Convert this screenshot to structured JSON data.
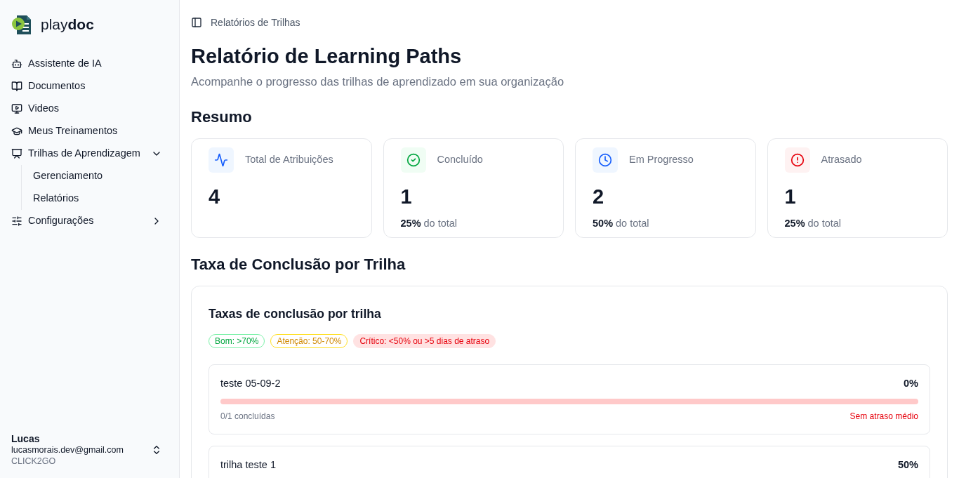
{
  "sidebar": {
    "logo": "play**doc**",
    "items": [
      {
        "kind": "bot",
        "label": "Assistente de IA"
      },
      {
        "kind": "book",
        "label": "Documentos"
      },
      {
        "kind": "monitor",
        "label": "Videos"
      },
      {
        "kind": "graduation",
        "label": "Meus Treinamentos"
      },
      {
        "kind": "presentation",
        "label": "Trilhas de Aprendizagem",
        "expanded": true,
        "children": [
          {
            "label": "Gerenciamento"
          },
          {
            "label": "Relatórios"
          }
        ]
      },
      {
        "kind": "sliders",
        "label": "Configurações",
        "expanded": false
      }
    ],
    "user": {
      "name": "Lucas",
      "email": "lucasmorais.dev@gmail.com",
      "org": "CLICK2GO"
    }
  },
  "breadcrumb": "Relatórios de Trilhas",
  "title": "Relatório de Learning Paths",
  "subtitle": "Acompanhe o progresso das trilhas de aprendizado em sua organização",
  "summary": {
    "heading": "Resumo",
    "cards": [
      {
        "kind": "total",
        "label": "Total de Atribuições",
        "value": "4"
      },
      {
        "kind": "done",
        "label": "Concluído",
        "value": "1",
        "share": "25%",
        "share_label": "do total"
      },
      {
        "kind": "progress",
        "label": "Em Progresso",
        "value": "2",
        "share": "50%",
        "share_label": "do total"
      },
      {
        "kind": "late",
        "label": "Atrasado",
        "value": "1",
        "share": "25%",
        "share_label": "do total"
      }
    ]
  },
  "completion": {
    "heading": "Taxa de Conclusão por Trilha",
    "card_title": "Taxas de conclusão por trilha",
    "legend": [
      {
        "kind": "good",
        "label": "Bom: >70%"
      },
      {
        "kind": "warn",
        "label": "Atenção: 50-70%"
      },
      {
        "kind": "critical",
        "label": "Crítico: <50% ou >5 dias de atraso"
      }
    ],
    "tracks": [
      {
        "name": "teste 05-09-2",
        "percent": "0%",
        "kind": "critical",
        "done": "0/1 concluídas",
        "delay": "Sem atraso médio"
      },
      {
        "name": "trilha teste 1",
        "percent": "50%"
      }
    ]
  }
}
